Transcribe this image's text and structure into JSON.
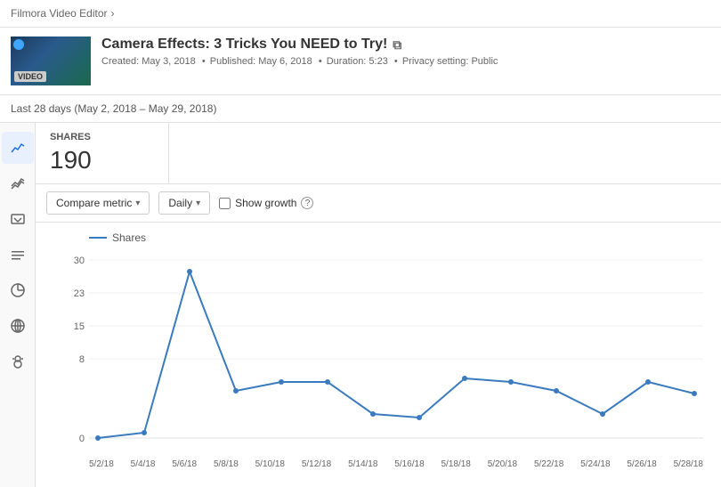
{
  "breadcrumb": {
    "parent": "Filmora Video Editor",
    "separator": "›"
  },
  "video": {
    "title": "Camera Effects: 3 Tricks You NEED to Try!",
    "badge": "VIDEO",
    "meta": {
      "created": "Created: May 3, 2018",
      "published": "Published: May 6, 2018",
      "duration": "Duration: 5:23",
      "privacy": "Privacy setting: Public"
    }
  },
  "date_range": "Last 28 days (May 2, 2018 – May 29, 2018)",
  "stats": {
    "label": "SHARES",
    "value": "190"
  },
  "controls": {
    "compare_metric": "Compare metric",
    "daily": "Daily",
    "show_growth": "Show growth"
  },
  "chart": {
    "legend": "Shares",
    "y_labels": [
      "30",
      "23",
      "15",
      "8",
      "0"
    ],
    "x_labels": [
      "5/2/18",
      "5/4/18",
      "5/6/18",
      "5/8/18",
      "5/10/18",
      "5/12/18",
      "5/14/18",
      "5/16/18",
      "5/18/18",
      "5/20/18",
      "5/22/18",
      "5/24/18",
      "5/26/18",
      "5/28/18"
    ]
  },
  "sidebar": {
    "icons": [
      {
        "name": "analytics-icon",
        "symbol": "〜",
        "active": true
      },
      {
        "name": "trends-icon",
        "symbol": "≋",
        "active": false
      },
      {
        "name": "reach-icon",
        "symbol": "✉",
        "active": false
      },
      {
        "name": "engagement-icon",
        "symbol": "≡",
        "active": false
      },
      {
        "name": "revenue-icon",
        "symbol": "◑",
        "active": false
      },
      {
        "name": "audience-icon",
        "symbol": "⊕",
        "active": false
      },
      {
        "name": "subtitles-icon",
        "symbol": "✦",
        "active": false
      }
    ]
  }
}
